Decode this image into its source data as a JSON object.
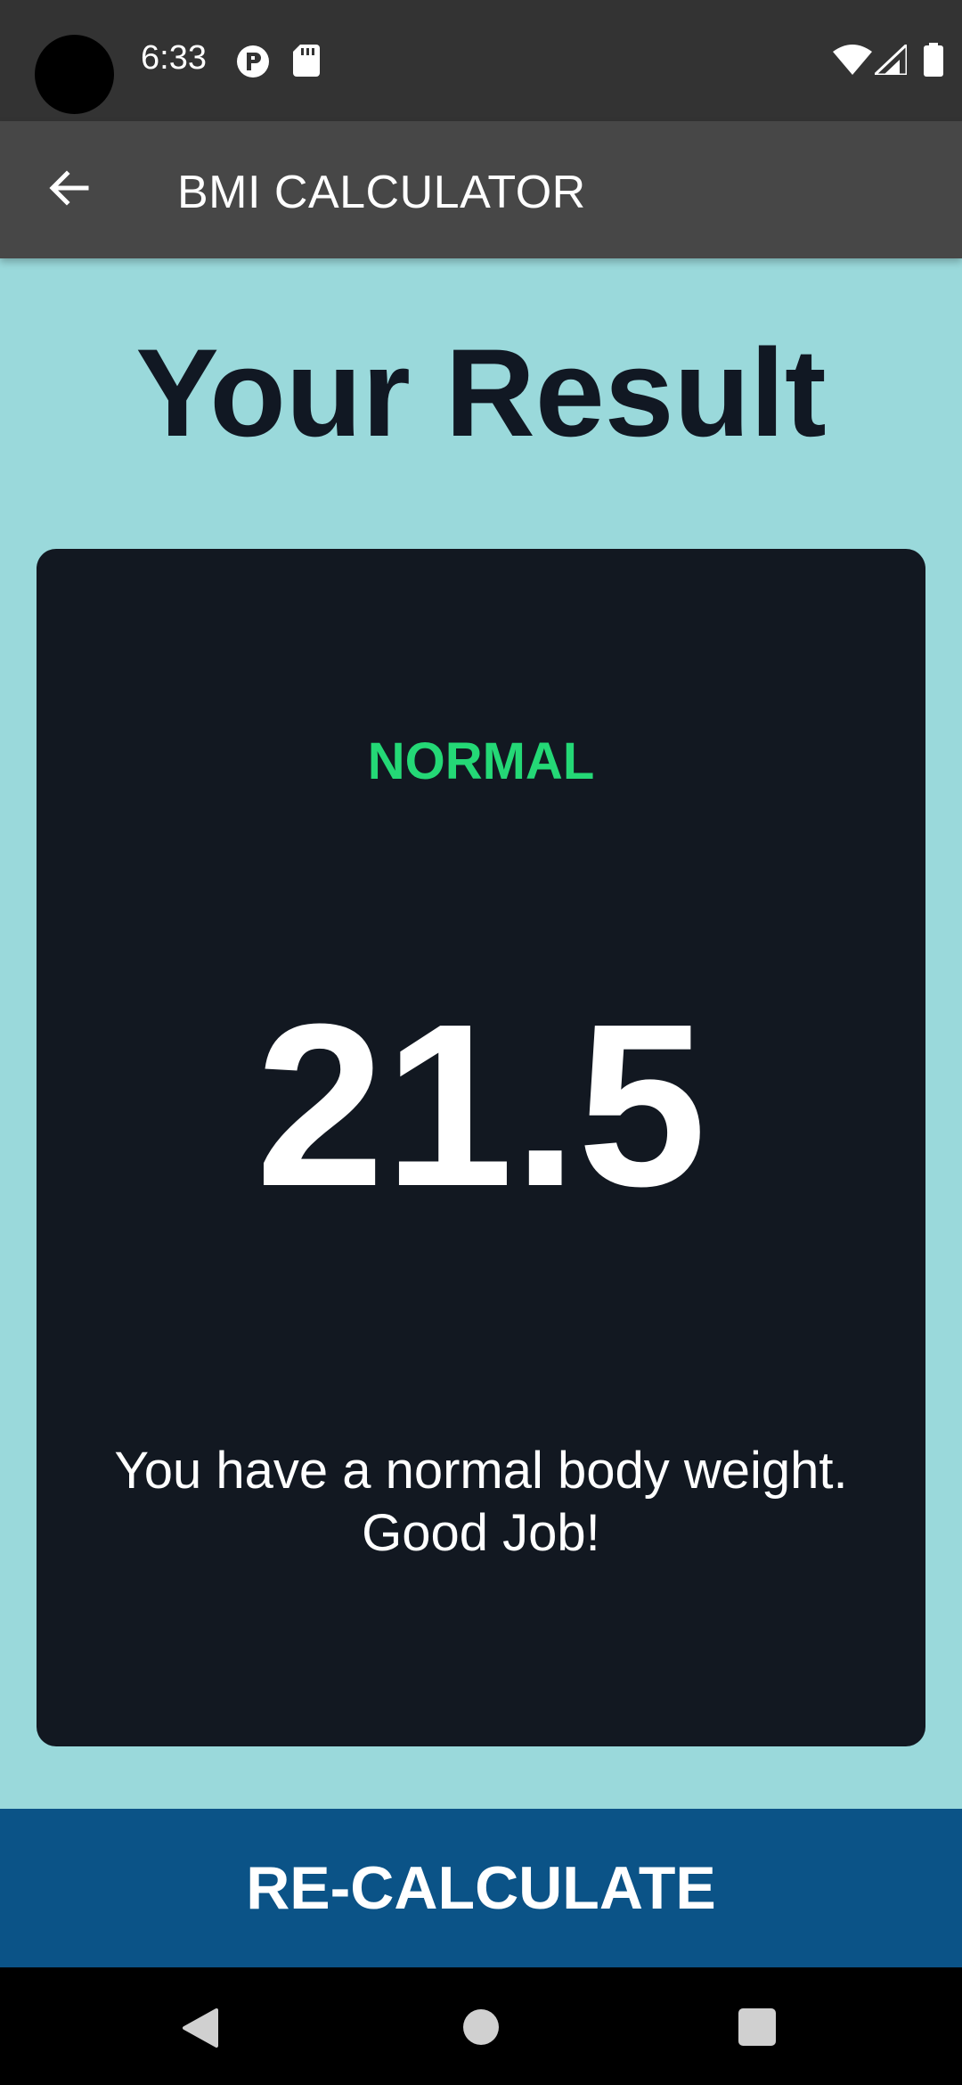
{
  "status_bar": {
    "time": "6:33",
    "icons": [
      "p-icon",
      "sd-card-icon",
      "wifi-icon",
      "signal-icon",
      "battery-icon"
    ]
  },
  "app_bar": {
    "title": "BMI CALCULATOR",
    "back_icon": "arrow-back-icon"
  },
  "main": {
    "heading": "Your Result",
    "result": {
      "status": "NORMAL",
      "value": "21.5",
      "message": "You have a normal body weight. Good Job!"
    },
    "recalculate_label": "RE-CALCULATE"
  },
  "nav_bar": {
    "icons": [
      "nav-back-icon",
      "nav-home-icon",
      "nav-recents-icon"
    ]
  },
  "colors": {
    "background": "#9ad9db",
    "status_bar": "#333333",
    "app_bar": "#474747",
    "card": "#121821",
    "status_green": "#24d876",
    "button": "#0b5387"
  }
}
